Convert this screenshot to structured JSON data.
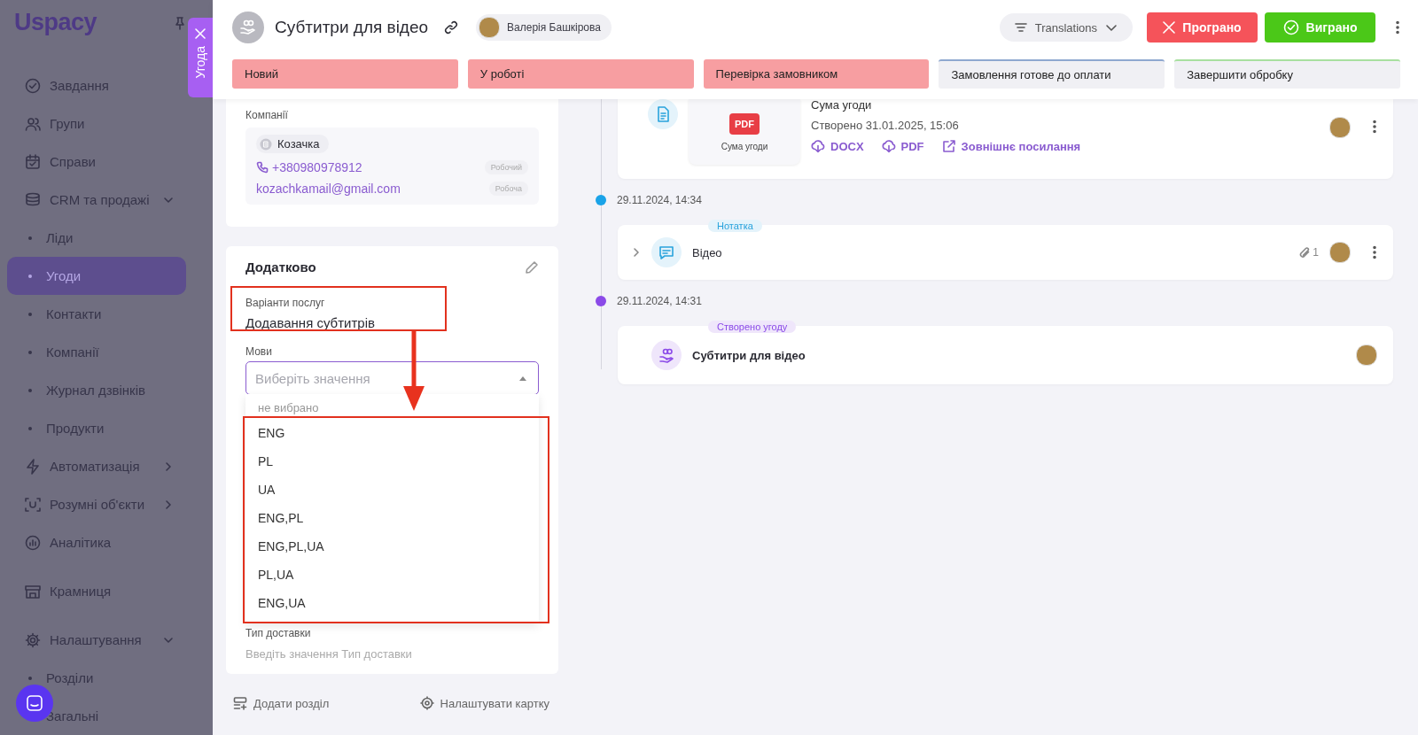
{
  "sidebar": {
    "logo": "Uspacy",
    "groups": [
      [
        {
          "label": "Завдання",
          "kind": "link",
          "selected": false
        },
        {
          "label": "Групи",
          "kind": "link",
          "selected": false
        },
        {
          "label": "Справи",
          "kind": "link",
          "selected": false
        },
        {
          "label": "CRM та продажі",
          "kind": "section",
          "expanded": true,
          "selected": false
        },
        {
          "label": "Ліди",
          "kind": "subitem",
          "selected": false
        },
        {
          "label": "Угоди",
          "kind": "subitem",
          "selected": true
        },
        {
          "label": "Контакти",
          "kind": "subitem",
          "selected": false
        },
        {
          "label": "Компанії",
          "kind": "subitem",
          "selected": false
        },
        {
          "label": "Журнал дзвінків",
          "kind": "subitem",
          "selected": false
        },
        {
          "label": "Продукти",
          "kind": "subitem",
          "selected": false
        },
        {
          "label": "Автоматизація",
          "kind": "section",
          "expanded": false,
          "selected": false
        },
        {
          "label": "Розумні об'єкти",
          "kind": "section",
          "expanded": false,
          "selected": false
        },
        {
          "label": "Аналітика",
          "kind": "link",
          "selected": false
        }
      ],
      [
        {
          "label": "Крамниця",
          "kind": "link",
          "selected": false
        }
      ],
      [
        {
          "label": "Налаштування",
          "kind": "section",
          "expanded": true,
          "selected": false
        },
        {
          "label": "Розділи",
          "kind": "subitem",
          "selected": false
        },
        {
          "label": "Загальні",
          "kind": "subitem",
          "selected": false
        }
      ]
    ]
  },
  "drawer_tab": {
    "label": "Угода"
  },
  "header": {
    "title": "Субтитри для відео",
    "owner": "Валерія Башкірова",
    "pipeline": "Translations",
    "lose_button": "Програно",
    "win_button": "Виграно"
  },
  "stages": [
    {
      "label": "Новий",
      "passed": true,
      "color": "#f79ea1"
    },
    {
      "label": "У роботі",
      "passed": true,
      "color": "#f79ea1"
    },
    {
      "label": "Перевірка замовником",
      "passed": true,
      "color": "#f79ea1"
    },
    {
      "label": "Замовлення готове до оплати",
      "passed": false,
      "color": "#8fa8d0"
    },
    {
      "label": "Завершити обробку",
      "passed": false,
      "color": "#a8e0a0"
    }
  ],
  "contact_card": {
    "label": "Компанії",
    "company": "Козачка",
    "phone": "+380980978912",
    "phone_type": "Робочий",
    "email": "kozachkamail@gmail.com",
    "email_type": "Робоча"
  },
  "extra_card": {
    "title": "Додатково",
    "fields": [
      {
        "label": "Варіанти послуг",
        "value": "Додавання субтитрів"
      }
    ],
    "languages": {
      "label": "Мови",
      "placeholder": "Виберіть значення",
      "expanded": true,
      "options": [
        {
          "label": "не вибрано",
          "kind": "empty"
        },
        {
          "label": "ENG",
          "kind": "option"
        },
        {
          "label": "PL",
          "kind": "option"
        },
        {
          "label": "UA",
          "kind": "option"
        },
        {
          "label": "ENG,PL",
          "kind": "option"
        },
        {
          "label": "ENG,PL,UA",
          "kind": "option"
        },
        {
          "label": "PL,UA",
          "kind": "option"
        },
        {
          "label": "ENG,UA",
          "kind": "option"
        }
      ]
    },
    "delivery": {
      "label": "Тип доставки",
      "placeholder": "Введіть значення Тип доставки"
    }
  },
  "footer_actions": [
    "Додати розділ",
    "Налаштувати картку"
  ],
  "timeline": [
    {
      "kind": "document",
      "title": "Сума угоди",
      "thumb_label": "PDF",
      "thumb_caption": "Сума угоди",
      "created": "Створено 31.01.2025, 15:06",
      "links": [
        "DOCX",
        "PDF",
        "Зовнішнє посилання"
      ]
    },
    {
      "kind": "note",
      "date": "29.11.2024, 14:34",
      "color": "#1aa3e8",
      "tag": "Нотатка",
      "title": "Відео",
      "attachments": "1"
    },
    {
      "kind": "deal",
      "date": "29.11.2024, 14:31",
      "color": "#8b4ae8",
      "tag": "Створено угоду",
      "title": "Субтитри для відео"
    }
  ]
}
